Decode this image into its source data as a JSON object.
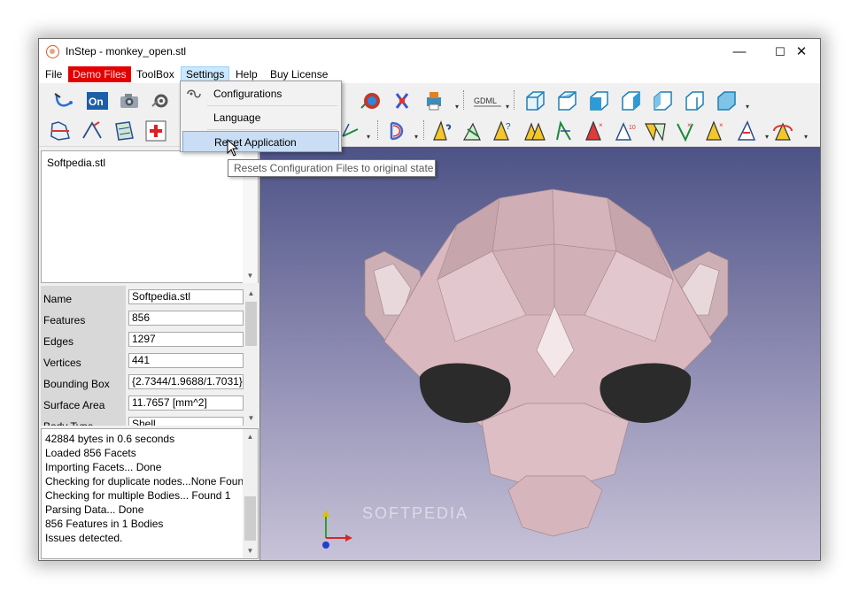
{
  "window": {
    "title": "InStep   - monkey_open.stl",
    "controls": {
      "minimize": "—",
      "maximize": "☐",
      "close": "✕"
    }
  },
  "menubar": {
    "items": [
      {
        "label": "File"
      },
      {
        "label": "Demo Files",
        "color": "#e40000"
      },
      {
        "label": "ToolBox"
      },
      {
        "label": "Settings",
        "state": "open"
      },
      {
        "label": "Help"
      },
      {
        "label": "Buy License"
      }
    ]
  },
  "settings_menu": {
    "items": [
      {
        "label": "Configurations",
        "icon": "configurations-icon"
      },
      {
        "label": "Language"
      },
      {
        "label": "Reset Application",
        "highlighted": true
      }
    ],
    "tooltip": "Resets Configuration Files to original state"
  },
  "toolbar": {
    "gdml_label": "GDML",
    "on_label": "On"
  },
  "tree": {
    "items": [
      "Softpedia.stl"
    ]
  },
  "properties": {
    "rows": [
      {
        "name": "Name",
        "value": "Softpedia.stl"
      },
      {
        "name": "Features",
        "value": "856"
      },
      {
        "name": "Edges",
        "value": "1297"
      },
      {
        "name": "Vertices",
        "value": "441"
      },
      {
        "name": "Bounding Box",
        "value": "{2.7344/1.9688/1.7031}"
      },
      {
        "name": "Surface Area",
        "value": "11.7657 [mm^2]"
      },
      {
        "name": "Body Type",
        "value": "Shell"
      }
    ]
  },
  "log": {
    "lines": [
      "42884 bytes in 0.6 seconds",
      "Loaded 856 Facets",
      "Importing Facets... Done",
      "Checking for duplicate nodes...None Found",
      "Checking for multiple Bodies... Found 1",
      "Parsing Data... Done",
      "856 Features in 1 Bodies",
      "Issues detected."
    ]
  },
  "viewport": {
    "watermark": "SOFTPEDIA",
    "model_color": "#d9b8bf",
    "background_top": "#4d5386",
    "background_bottom": "#c8c3d8"
  }
}
